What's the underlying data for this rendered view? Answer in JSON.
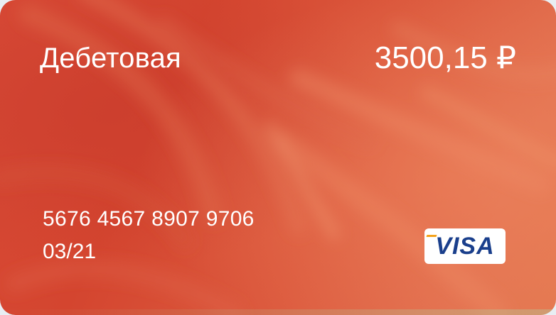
{
  "card": {
    "type_label": "Дебетовая",
    "balance": "3500,15 ₽",
    "number": "5676 4567 8907 9706",
    "expiry": "03/21",
    "network": "VISA"
  },
  "colors": {
    "card_primary": "#d84a36",
    "card_secondary": "#e3774f",
    "visa_blue": "#1a3f8c",
    "visa_gold": "#f4a21b"
  }
}
